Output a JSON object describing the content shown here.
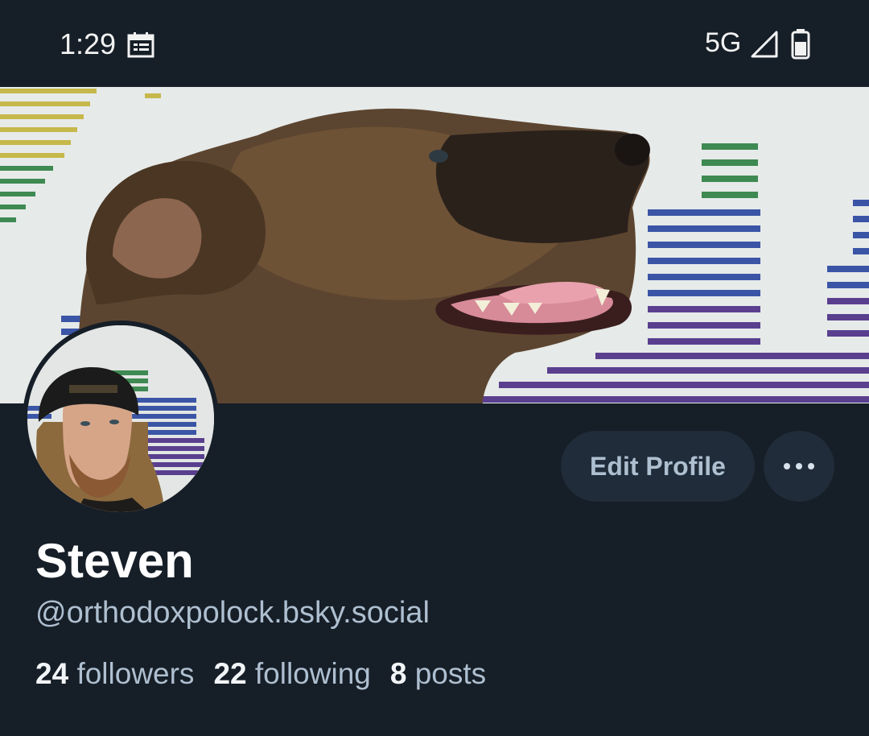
{
  "status_bar": {
    "time": "1:29",
    "network": "5G",
    "icons": [
      "calendar-icon",
      "signal-icon",
      "battery-icon"
    ]
  },
  "profile": {
    "display_name": "Steven",
    "handle": "@orthodoxpolock.bsky.social",
    "stats": {
      "followers_count": "24",
      "followers_label": "followers",
      "following_count": "22",
      "following_label": "following",
      "posts_count": "8",
      "posts_label": "posts"
    }
  },
  "actions": {
    "edit_profile_label": "Edit Profile",
    "more_icon": "more-horizontal-icon"
  },
  "colors": {
    "background": "#161e27",
    "button_bg": "#202c39",
    "secondary_text": "#aebfd0"
  }
}
